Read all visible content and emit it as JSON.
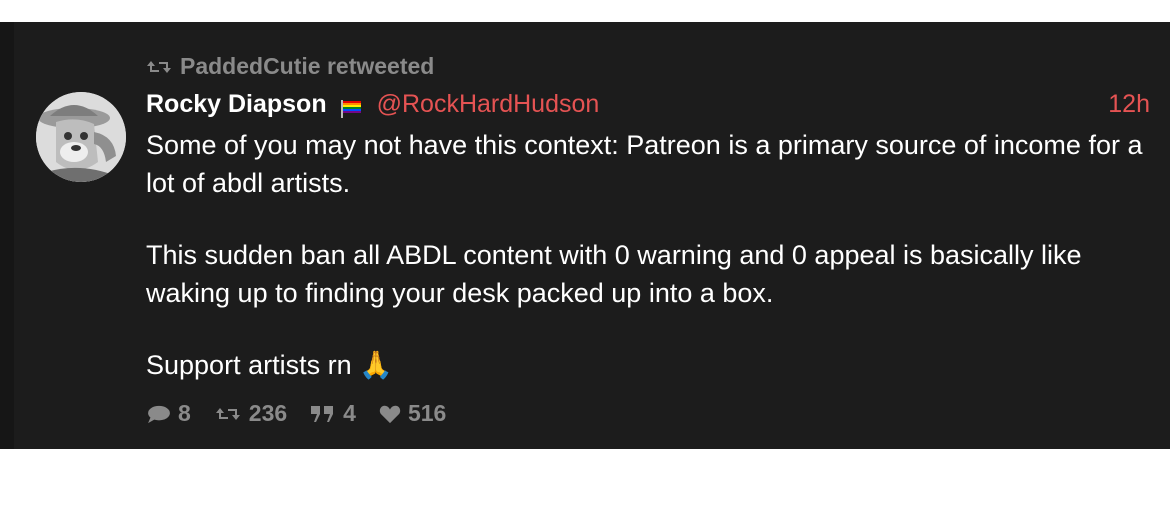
{
  "retweet": {
    "icon": "retweet-icon",
    "text": "PaddedCutie retweeted"
  },
  "author": {
    "display_name": "Rocky Diapson",
    "flag_icon": "rainbow-flag-icon",
    "handle": "@RockHardHudson",
    "time": "12h"
  },
  "content": {
    "paragraphs": [
      "Some of you may not have this context: Patreon is a primary source of income for a lot of abdl artists.",
      "This sudden ban all ABDL content with 0 warning and 0 appeal is basically like waking up to finding your desk packed up into a box.",
      "Support artists rn 🙏"
    ]
  },
  "actions": {
    "replies": "8",
    "retweets": "236",
    "quotes": "4",
    "likes": "516"
  },
  "colors": {
    "card_bg": "#1c1c1c",
    "accent": "#e55353",
    "muted": "#8a8a8a"
  }
}
